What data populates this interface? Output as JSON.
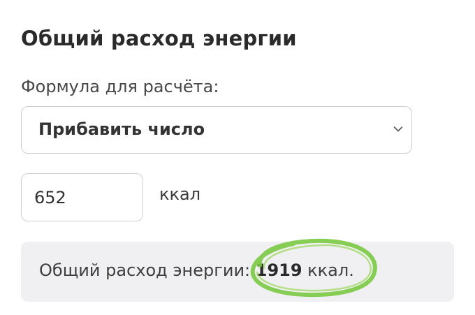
{
  "card": {
    "title": "Общий расход энергии"
  },
  "formula": {
    "label": "Формула для расчёта:",
    "selected": "Прибавить число",
    "chevron_icon": "chevron-down-icon"
  },
  "amount": {
    "value": "652",
    "unit": "ккал"
  },
  "result": {
    "prefix": "Общий расход энергии: ",
    "value": "1919",
    "suffix": " ккал."
  },
  "colors": {
    "highlight_stroke": "#7ac943",
    "result_background": "#f0f0f2",
    "border": "#cfcfcf"
  }
}
